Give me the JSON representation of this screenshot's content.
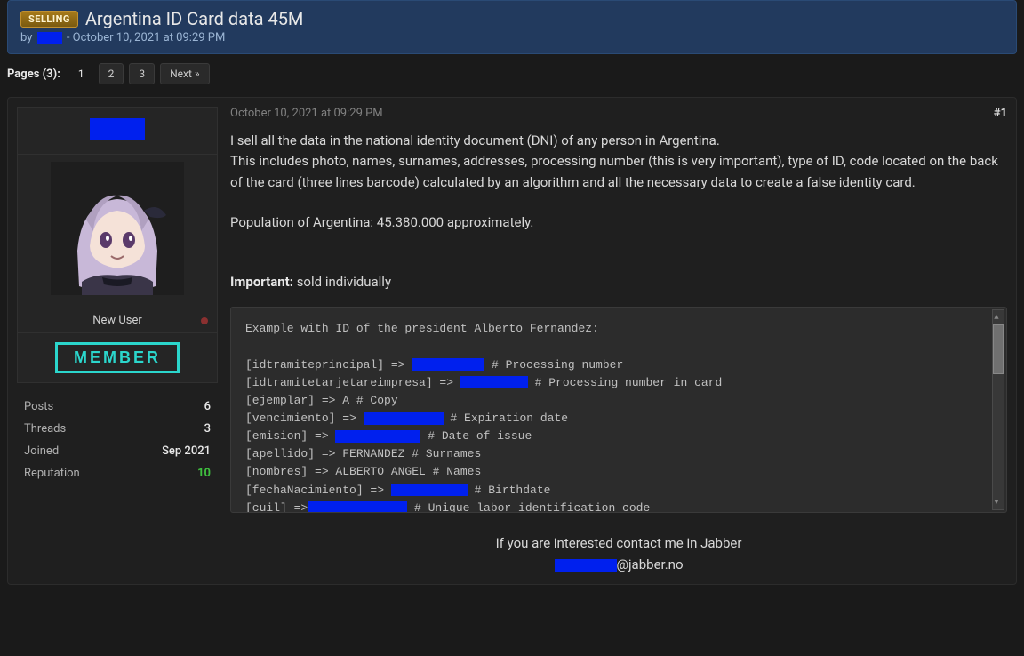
{
  "header": {
    "tag": "SELLING",
    "title": "Argentina ID Card data 45M",
    "by_prefix": "by",
    "by_date": "- October 10, 2021 at 09:29 PM"
  },
  "pagination": {
    "label": "Pages (3):",
    "current": "1",
    "p2": "2",
    "p3": "3",
    "next": "Next »"
  },
  "user": {
    "role": "New User",
    "badge": "MEMBER",
    "stats": {
      "posts_label": "Posts",
      "posts_val": "6",
      "threads_label": "Threads",
      "threads_val": "3",
      "joined_label": "Joined",
      "joined_val": "Sep 2021",
      "rep_label": "Reputation",
      "rep_val": "10"
    }
  },
  "post": {
    "date": "October 10, 2021 at 09:29 PM",
    "num": "#1",
    "line1": "I sell all the data in the national identity document (DNI) of any person in Argentina.",
    "line2": "This includes photo, names, surnames, addresses, processing number (this is very important), type of ID, code located on the back of the card (three lines barcode) calculated by an algorithm and all the necessary data to create a false identity card.",
    "line3": "Population of Argentina: 45.380.000 approximately.",
    "important_label": "Important:",
    "important_text": " sold individually",
    "code": {
      "l1": "Example with ID of the president Alberto Fernandez:",
      "l2a": "[idtramiteprincipal] => ",
      "l2b": "    # Processing number",
      "l3a": "[idtramitetarjetareimpresa] => ",
      "l3b": "     # Processing number in card",
      "l4": "[ejemplar] => A     # Copy",
      "l5a": "[vencimiento] => ",
      "l5b": "     # Expiration date",
      "l6a": "[emision] => ",
      "l6b": "    # Date of issue",
      "l7": "[apellido] => FERNANDEZ    # Surnames",
      "l8": "[nombres] => ALBERTO ANGEL    # Names",
      "l9a": "[fechaNacimiento] => ",
      "l9b": "     # Birthdate",
      "l10a": "[cuil] =>",
      "l10b": "    # Unique labor identification code"
    },
    "contact1": "If you are interested contact me in Jabber",
    "contact2": "@jabber.no"
  }
}
